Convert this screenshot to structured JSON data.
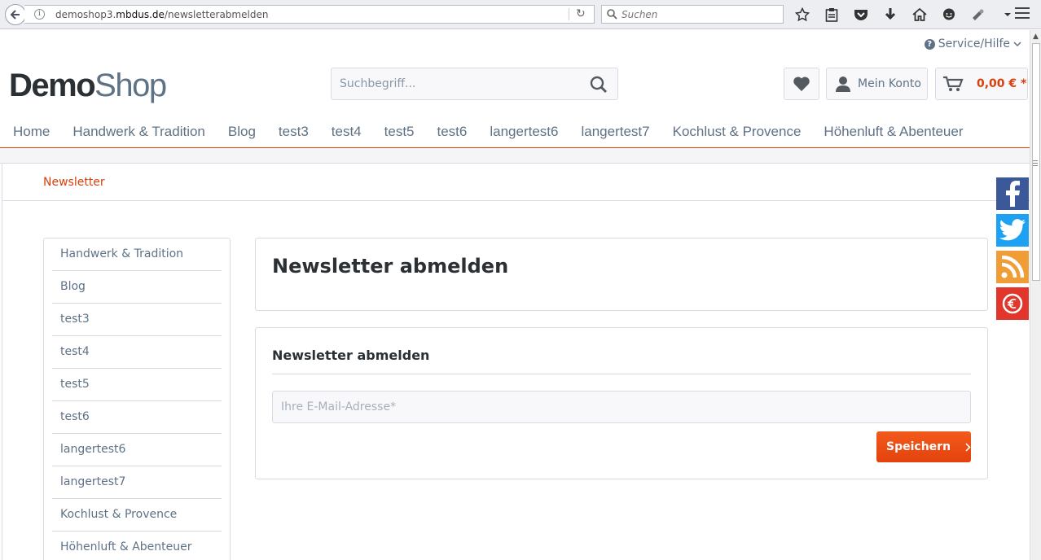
{
  "browser": {
    "url_host": "demoshop3.",
    "url_domain": "mbdus.de",
    "url_path": "/newsletterabmelden",
    "search_placeholder": "Suchen"
  },
  "header": {
    "service_label": "Service/Hilfe",
    "logo_demo": "Demo",
    "logo_shop": "Shop",
    "search_placeholder": "Suchbegriff...",
    "account_label": "Mein Konto",
    "cart_amount": "0,00 € *"
  },
  "mainnav": [
    "Home",
    "Handwerk & Tradition",
    "Blog",
    "test3",
    "test4",
    "test5",
    "test6",
    "langertest6",
    "langertest7",
    "Kochlust & Provence",
    "Höhenluft & Abenteuer"
  ],
  "breadcrumb": "Newsletter",
  "sidebar": [
    "Handwerk & Tradition",
    "Blog",
    "test3",
    "test4",
    "test5",
    "test6",
    "langertest6",
    "langertest7",
    "Kochlust & Provence",
    "Höhenluft & Abenteuer"
  ],
  "main": {
    "page_title": "Newsletter abmelden",
    "form_title": "Newsletter abmelden",
    "email_placeholder": "Ihre E-Mail-Adresse*",
    "save_label": "Speichern"
  },
  "colors": {
    "accent": "#d9400b",
    "text": "#5f7285",
    "facebook": "#3b5998",
    "twitter": "#1da1f2",
    "rss": "#f09d38",
    "euro": "#e2352b"
  },
  "icons": [
    "back-arrow-icon",
    "info-icon",
    "reload-icon",
    "search-icon",
    "star-icon",
    "reading-list-icon",
    "pocket-icon",
    "download-icon",
    "home-icon",
    "chat-icon",
    "extension-icon",
    "menu-icon",
    "question-icon",
    "heart-icon",
    "user-icon",
    "cart-icon",
    "chevron-right-icon",
    "facebook-icon",
    "twitter-icon",
    "rss-icon",
    "euro-icon"
  ]
}
